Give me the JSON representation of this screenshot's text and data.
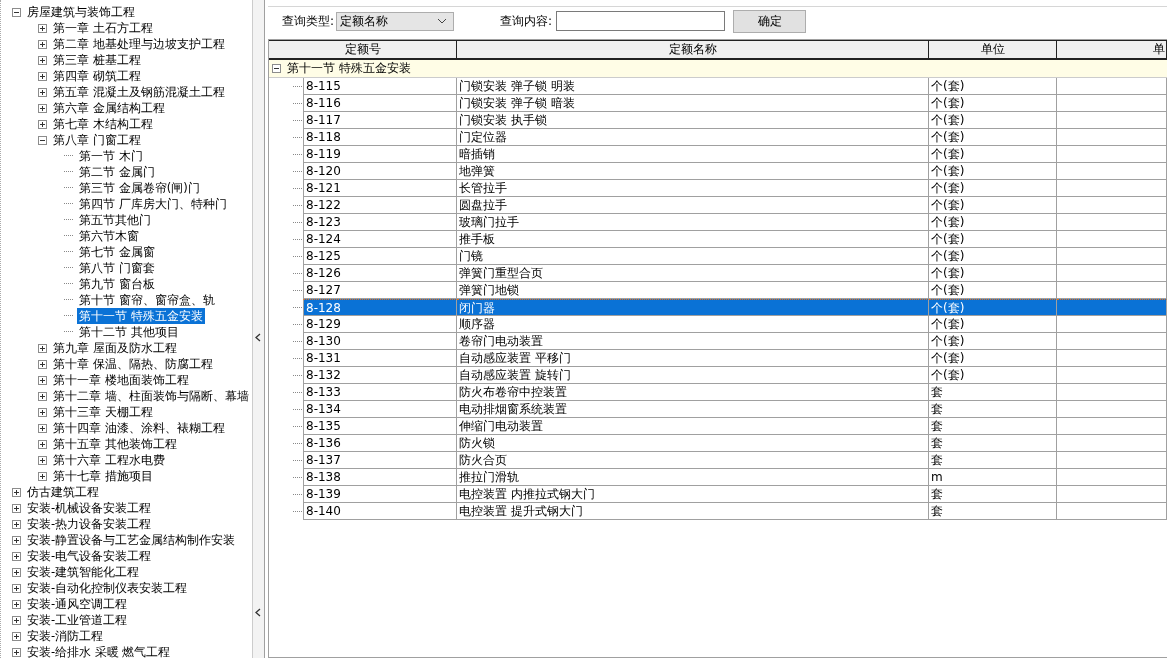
{
  "tree": [
    {
      "label": "房屋建筑与装饰工程",
      "expanded": true,
      "children": [
        {
          "label": "第一章  土石方工程",
          "expanded": false
        },
        {
          "label": "第二章  地基处理与边坡支护工程",
          "expanded": false
        },
        {
          "label": "第三章  桩基工程",
          "expanded": false
        },
        {
          "label": "第四章  砌筑工程",
          "expanded": false
        },
        {
          "label": "第五章  混凝土及钢筋混凝土工程",
          "expanded": false
        },
        {
          "label": "第六章  金属结构工程",
          "expanded": false
        },
        {
          "label": "第七章  木结构工程",
          "expanded": false
        },
        {
          "label": "第八章  门窗工程",
          "expanded": true,
          "children": [
            {
              "label": "第一节  木门",
              "selected": false
            },
            {
              "label": "第二节  金属门",
              "selected": false
            },
            {
              "label": "第三节  金属卷帘(闸)门",
              "selected": false
            },
            {
              "label": "第四节  厂库房大门、特种门",
              "selected": false
            },
            {
              "label": "第五节其他门",
              "selected": false
            },
            {
              "label": "第六节木窗",
              "selected": false
            },
            {
              "label": "第七节  金属窗",
              "selected": false
            },
            {
              "label": "第八节  门窗套",
              "selected": false
            },
            {
              "label": "第九节  窗台板",
              "selected": false
            },
            {
              "label": "第十节  窗帘、窗帘盒、轨",
              "selected": false
            },
            {
              "label": "第十一节  特殊五金安装",
              "selected": true
            },
            {
              "label": "第十二节  其他项目",
              "selected": false
            }
          ]
        },
        {
          "label": "第九章  屋面及防水工程",
          "expanded": false
        },
        {
          "label": "第十章  保温、隔热、防腐工程",
          "expanded": false
        },
        {
          "label": "第十一章  楼地面装饰工程",
          "expanded": false
        },
        {
          "label": "第十二章  墙、柱面装饰与隔断、幕墙",
          "expanded": false
        },
        {
          "label": "第十三章  天棚工程",
          "expanded": false
        },
        {
          "label": "第十四章  油漆、涂料、裱糊工程",
          "expanded": false
        },
        {
          "label": "第十五章  其他装饰工程",
          "expanded": false
        },
        {
          "label": "第十六章  工程水电费",
          "expanded": false
        },
        {
          "label": "第十七章  措施项目",
          "expanded": false
        }
      ]
    },
    {
      "label": "仿古建筑工程",
      "expanded": false
    },
    {
      "label": "安装-机械设备安装工程",
      "expanded": false
    },
    {
      "label": "安装-热力设备安装工程",
      "expanded": false
    },
    {
      "label": "安装-静置设备与工艺金属结构制作安装",
      "expanded": false
    },
    {
      "label": "安装-电气设备安装工程",
      "expanded": false
    },
    {
      "label": "安装-建筑智能化工程",
      "expanded": false
    },
    {
      "label": "安装-自动化控制仪表安装工程",
      "expanded": false
    },
    {
      "label": "安装-通风空调工程",
      "expanded": false
    },
    {
      "label": "安装-工业管道工程",
      "expanded": false
    },
    {
      "label": "安装-消防工程",
      "expanded": false
    },
    {
      "label": "安装-给排水 采暖 燃气工程",
      "expanded": false
    }
  ],
  "query": {
    "type_label": "查询类型:",
    "type_value": "定额名称",
    "content_label": "查询内容:",
    "confirm_button": "确定"
  },
  "table": {
    "columns": [
      "定额号",
      "定额名称",
      "单位",
      "单"
    ],
    "group": {
      "label": "第十一节  特殊五金安装",
      "expanded": true
    },
    "rows": [
      {
        "code": "8-115",
        "name": "门锁安装  弹子锁  明装",
        "unit": "个(套)",
        "selected": false
      },
      {
        "code": "8-116",
        "name": "门锁安装  弹子锁  暗装",
        "unit": "个(套)",
        "selected": false
      },
      {
        "code": "8-117",
        "name": "门锁安装  执手锁",
        "unit": "个(套)",
        "selected": false
      },
      {
        "code": "8-118",
        "name": "门定位器",
        "unit": "个(套)",
        "selected": false
      },
      {
        "code": "8-119",
        "name": "暗插销",
        "unit": "个(套)",
        "selected": false
      },
      {
        "code": "8-120",
        "name": "地弹簧",
        "unit": "个(套)",
        "selected": false
      },
      {
        "code": "8-121",
        "name": "长管拉手",
        "unit": "个(套)",
        "selected": false
      },
      {
        "code": "8-122",
        "name": "圆盘拉手",
        "unit": "个(套)",
        "selected": false
      },
      {
        "code": "8-123",
        "name": "玻璃门拉手",
        "unit": "个(套)",
        "selected": false
      },
      {
        "code": "8-124",
        "name": "推手板",
        "unit": "个(套)",
        "selected": false
      },
      {
        "code": "8-125",
        "name": "门镜",
        "unit": "个(套)",
        "selected": false
      },
      {
        "code": "8-126",
        "name": "弹簧门重型合页",
        "unit": "个(套)",
        "selected": false
      },
      {
        "code": "8-127",
        "name": "弹簧门地锁",
        "unit": "个(套)",
        "selected": false
      },
      {
        "code": "8-128",
        "name": "闭门器",
        "unit": "个(套)",
        "selected": true
      },
      {
        "code": "8-129",
        "name": "顺序器",
        "unit": "个(套)",
        "selected": false
      },
      {
        "code": "8-130",
        "name": "卷帘门电动装置",
        "unit": "个(套)",
        "selected": false
      },
      {
        "code": "8-131",
        "name": "自动感应装置  平移门",
        "unit": "个(套)",
        "selected": false
      },
      {
        "code": "8-132",
        "name": "自动感应装置  旋转门",
        "unit": "个(套)",
        "selected": false
      },
      {
        "code": "8-133",
        "name": "防火布卷帘中控装置",
        "unit": "套",
        "selected": false
      },
      {
        "code": "8-134",
        "name": "电动排烟窗系统装置",
        "unit": "套",
        "selected": false
      },
      {
        "code": "8-135",
        "name": "伸缩门电动装置",
        "unit": "套",
        "selected": false
      },
      {
        "code": "8-136",
        "name": "防火锁",
        "unit": "套",
        "selected": false
      },
      {
        "code": "8-137",
        "name": "防火合页",
        "unit": "套",
        "selected": false
      },
      {
        "code": "8-138",
        "name": "推拉门滑轨",
        "unit": "m",
        "selected": false
      },
      {
        "code": "8-139",
        "name": "电控装置  内推拉式钢大门",
        "unit": "套",
        "selected": false
      },
      {
        "code": "8-140",
        "name": "电控装置  提升式钢大门",
        "unit": "套",
        "selected": false
      }
    ]
  }
}
